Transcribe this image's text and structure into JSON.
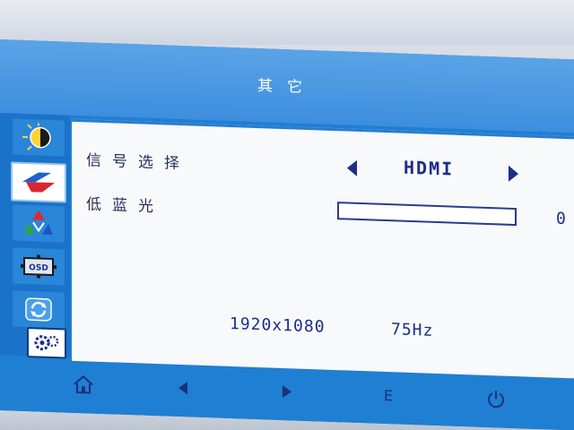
{
  "title": "其它",
  "sidebar": {
    "items": [
      {
        "name": "brightness-contrast-icon",
        "active": false
      },
      {
        "name": "image-setup-icon",
        "active": true
      },
      {
        "name": "color-setting-icon",
        "active": false
      },
      {
        "name": "osd-setting-icon",
        "active": false
      },
      {
        "name": "reset-icon",
        "active": false
      },
      {
        "name": "other-settings-icon",
        "active": false
      }
    ]
  },
  "settings": {
    "signal_label": "信号选择",
    "signal_value": "HDMI",
    "blue_light_label": "低蓝光",
    "blue_light_value": "0",
    "blue_light_level": 0
  },
  "info": {
    "resolution": "1920x1080",
    "refresh_rate": "75Hz"
  },
  "footer": {
    "enter_label": "E",
    "buttons": [
      "home-icon",
      "left-arrow-icon",
      "right-arrow-icon",
      "enter-button",
      "power-icon"
    ]
  },
  "colors": {
    "osd_blue": "#1f7fd2",
    "text_navy": "#1d2d8a",
    "panel_bg": "#f7f9fb"
  }
}
